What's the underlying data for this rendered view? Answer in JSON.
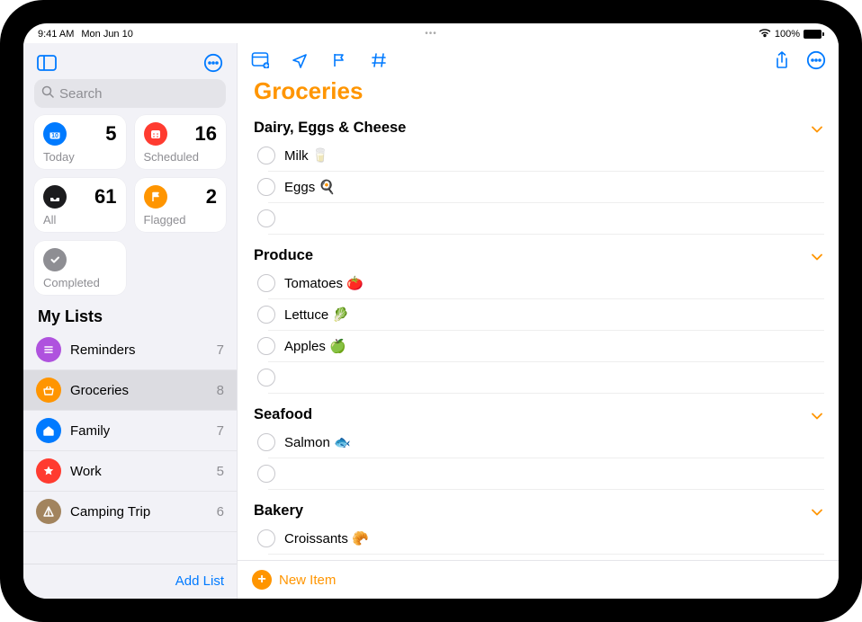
{
  "status": {
    "time": "9:41 AM",
    "date": "Mon Jun 10",
    "battery_pct": "100%"
  },
  "sidebar": {
    "search_placeholder": "Search",
    "tiles": {
      "today": {
        "label": "Today",
        "count": "5"
      },
      "scheduled": {
        "label": "Scheduled",
        "count": "16"
      },
      "all": {
        "label": "All",
        "count": "61"
      },
      "flagged": {
        "label": "Flagged",
        "count": "2"
      },
      "completed": {
        "label": "Completed"
      }
    },
    "lists_header": "My Lists",
    "lists": [
      {
        "name": "Reminders",
        "count": "7",
        "color": "c-purple",
        "icon": "list"
      },
      {
        "name": "Groceries",
        "count": "8",
        "color": "c-orange",
        "icon": "basket",
        "selected": true
      },
      {
        "name": "Family",
        "count": "7",
        "color": "c-blue",
        "icon": "house"
      },
      {
        "name": "Work",
        "count": "5",
        "color": "c-red",
        "icon": "star"
      },
      {
        "name": "Camping Trip",
        "count": "6",
        "color": "c-brown",
        "icon": "tent"
      }
    ],
    "add_list": "Add List"
  },
  "main": {
    "title": "Groceries",
    "sections": [
      {
        "name": "Dairy, Eggs & Cheese",
        "items": [
          "Milk 🥛",
          "Eggs 🍳",
          ""
        ]
      },
      {
        "name": "Produce",
        "items": [
          "Tomatoes 🍅",
          "Lettuce 🥬",
          "Apples 🍏",
          ""
        ]
      },
      {
        "name": "Seafood",
        "items": [
          "Salmon 🐟",
          ""
        ]
      },
      {
        "name": "Bakery",
        "items": [
          "Croissants 🥐"
        ]
      }
    ],
    "new_item": "New Item"
  }
}
